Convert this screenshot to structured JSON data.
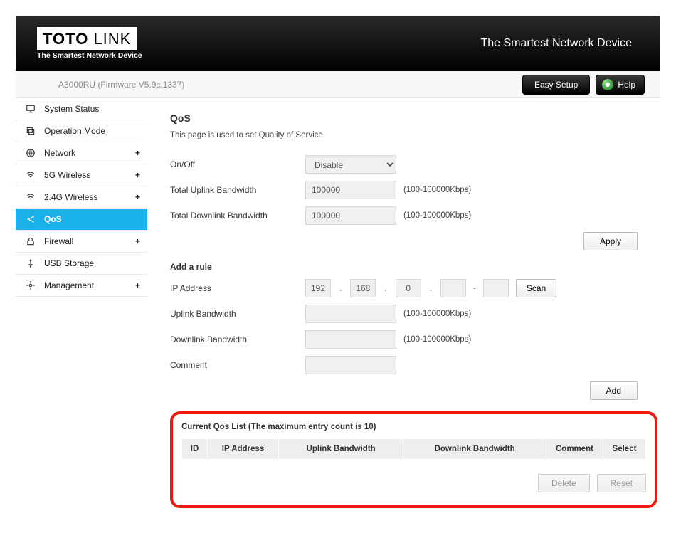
{
  "header": {
    "brand_main": "TOTO",
    "brand_sub": "LINK",
    "brand_tagline": "The Smartest Network Device",
    "slogan": "The Smartest Network Device"
  },
  "subheader": {
    "model_firmware": "A3000RU (Firmware V5.9c.1337)",
    "easy_setup": "Easy Setup",
    "help": "Help"
  },
  "sidebar": {
    "items": [
      {
        "label": "System Status",
        "icon": "monitor",
        "expandable": false
      },
      {
        "label": "Operation Mode",
        "icon": "copy",
        "expandable": false
      },
      {
        "label": "Network",
        "icon": "globe",
        "expandable": true
      },
      {
        "label": "5G Wireless",
        "icon": "wifi",
        "expandable": true
      },
      {
        "label": "2.4G Wireless",
        "icon": "wifi",
        "expandable": true
      },
      {
        "label": "QoS",
        "icon": "share",
        "expandable": false,
        "active": true
      },
      {
        "label": "Firewall",
        "icon": "lock",
        "expandable": true
      },
      {
        "label": "USB Storage",
        "icon": "usb",
        "expandable": false
      },
      {
        "label": "Management",
        "icon": "gear",
        "expandable": true
      }
    ]
  },
  "qos": {
    "title": "QoS",
    "description": "This page is used to set Quality of Service.",
    "onoff_label": "On/Off",
    "onoff_value": "Disable",
    "uplink_label": "Total Uplink Bandwidth",
    "uplink_value": "100000",
    "downlink_label": "Total Downlink Bandwidth",
    "downlink_value": "100000",
    "range_hint": "(100-100000Kbps)",
    "apply": "Apply",
    "add_rule_title": "Add a rule",
    "ip_label": "IP Address",
    "ip1": "192",
    "ip2": "168",
    "ip3": "0",
    "ip4": "",
    "ip5": "",
    "dash": "-",
    "scan": "Scan",
    "rule_uplink_label": "Uplink Bandwidth",
    "rule_downlink_label": "Downlink Bandwidth",
    "comment_label": "Comment",
    "add": "Add",
    "list_title": "Current Qos List  (The maximum entry count is 10)",
    "columns": {
      "id": "ID",
      "ip": "IP Address",
      "up": "Uplink Bandwidth",
      "down": "Downlink Bandwidth",
      "comment": "Comment",
      "select": "Select"
    },
    "delete": "Delete",
    "reset": "Reset"
  }
}
